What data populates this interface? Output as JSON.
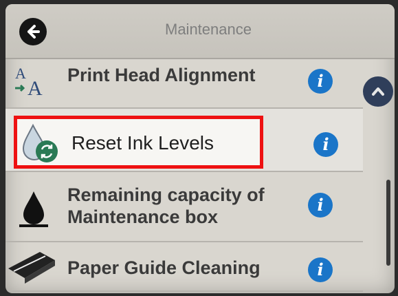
{
  "header": {
    "title": "Maintenance",
    "back_icon": "back-arrow-icon"
  },
  "menu": {
    "items": [
      {
        "label": "Print Head Alignment",
        "icon": "alignment-icon"
      },
      {
        "label": "Reset Ink Levels",
        "icon": "ink-reset-icon",
        "selected": true
      },
      {
        "label_line1": "Remaining capacity of",
        "label_line2": "Maintenance box",
        "icon": "ink-drop-icon"
      },
      {
        "label": "Paper Guide Cleaning",
        "icon": "paper-guide-icon"
      }
    ],
    "info_glyph": "i"
  },
  "colors": {
    "highlight": "#e11111",
    "info": "#1a75c8",
    "accent_green": "#2a7a55"
  }
}
